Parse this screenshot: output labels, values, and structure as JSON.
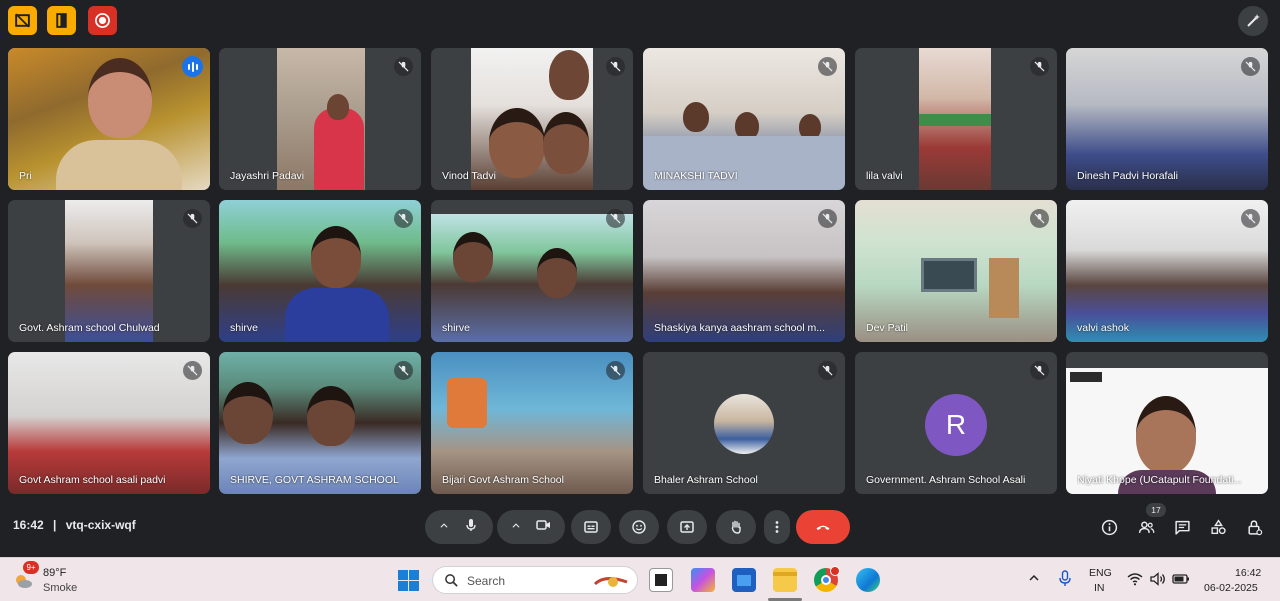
{
  "top_bar": {
    "buttons": [
      "layout-icon",
      "door-icon",
      "record-icon"
    ],
    "pen_icon": "pen-sparkle-icon"
  },
  "participants": [
    {
      "name": "Pri",
      "state": "speaking"
    },
    {
      "name": "Jayashri Padavi",
      "state": "muted"
    },
    {
      "name": "Vinod Tadvi",
      "state": "muted"
    },
    {
      "name": "MINAKSHI TADVI",
      "state": "muted"
    },
    {
      "name": "lila valvi",
      "state": "muted"
    },
    {
      "name": "Dinesh Padvi Horafali",
      "state": "muted"
    },
    {
      "name": "Govt. Ashram school Chulwad",
      "state": "muted"
    },
    {
      "name": "shirve",
      "state": "muted"
    },
    {
      "name": "shirve",
      "state": "muted"
    },
    {
      "name": "Shaskiya kanya aashram school m...",
      "state": "muted"
    },
    {
      "name": "Dev Patil",
      "state": "muted"
    },
    {
      "name": "valvi ashok",
      "state": "muted"
    },
    {
      "name": "Govt Ashram school asali padvi",
      "state": "muted"
    },
    {
      "name": "SHIRVE, GOVT ASHRAM SCHOOL",
      "state": "muted"
    },
    {
      "name": "Bijari Govt Ashram School",
      "state": "muted"
    },
    {
      "name": "Bhaler Ashram School",
      "state": "muted"
    },
    {
      "name": "Government. Ashram School Asali",
      "state": "muted",
      "avatar_letter": "R"
    },
    {
      "name": "Niyati Khope (UCatapult Foundati...",
      "state": "presenting"
    }
  ],
  "controls": {
    "time": "16:42",
    "separator": "|",
    "meeting_code": "vtq-cxix-wqf",
    "participant_count": "17",
    "end_call_color": "#ea4335"
  },
  "taskbar": {
    "weather_temp": "89°F",
    "weather_desc": "Smoke",
    "weather_badge": "9+",
    "search_label": "Search",
    "lang_top": "ENG",
    "lang_bottom": "IN",
    "clock_time": "16:42",
    "clock_date": "06-02-2025"
  },
  "colors": {
    "background": "#202124",
    "tile": "#3c4043",
    "accent": "#8ab4f8",
    "speaking": "#1a73e8",
    "avatar": "#7e57c2"
  }
}
